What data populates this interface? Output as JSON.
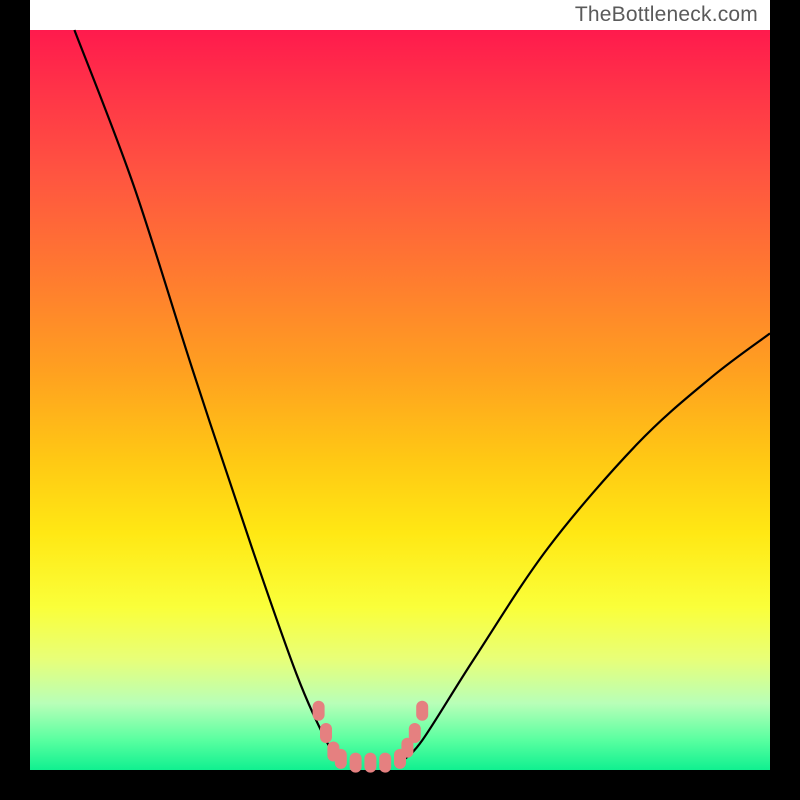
{
  "watermark": "TheBottleneck.com",
  "chart_data": {
    "type": "line",
    "title": "",
    "xlabel": "",
    "ylabel": "",
    "xlim": [
      0,
      100
    ],
    "ylim": [
      0,
      100
    ],
    "grid": false,
    "background": {
      "gradient": "vertical",
      "stops": [
        {
          "pos": 0,
          "color": "#ff1a4d"
        },
        {
          "pos": 50,
          "color": "#ffc010"
        },
        {
          "pos": 78,
          "color": "#faff3a"
        },
        {
          "pos": 100,
          "color": "#10f090"
        }
      ]
    },
    "annotations": [
      {
        "type": "spline",
        "name": "left-curve",
        "stroke": "#000000",
        "points": [
          {
            "x": 6,
            "y": 100
          },
          {
            "x": 14,
            "y": 79
          },
          {
            "x": 22,
            "y": 54
          },
          {
            "x": 30,
            "y": 30
          },
          {
            "x": 36,
            "y": 13
          },
          {
            "x": 40,
            "y": 4
          },
          {
            "x": 42,
            "y": 1
          }
        ]
      },
      {
        "type": "spline",
        "name": "right-curve",
        "stroke": "#000000",
        "points": [
          {
            "x": 50,
            "y": 1
          },
          {
            "x": 53,
            "y": 4
          },
          {
            "x": 60,
            "y": 15
          },
          {
            "x": 70,
            "y": 30
          },
          {
            "x": 82,
            "y": 44
          },
          {
            "x": 92,
            "y": 53
          },
          {
            "x": 100,
            "y": 59
          }
        ]
      },
      {
        "type": "marker-run",
        "name": "bottom-markers",
        "stroke": "#e58080",
        "points": [
          {
            "x": 39,
            "y": 8
          },
          {
            "x": 40,
            "y": 5
          },
          {
            "x": 41,
            "y": 2.5
          },
          {
            "x": 42,
            "y": 1.5
          },
          {
            "x": 44,
            "y": 1
          },
          {
            "x": 46,
            "y": 1
          },
          {
            "x": 48,
            "y": 1
          },
          {
            "x": 50,
            "y": 1.5
          },
          {
            "x": 51,
            "y": 3
          },
          {
            "x": 52,
            "y": 5
          },
          {
            "x": 53,
            "y": 8
          }
        ]
      }
    ]
  }
}
